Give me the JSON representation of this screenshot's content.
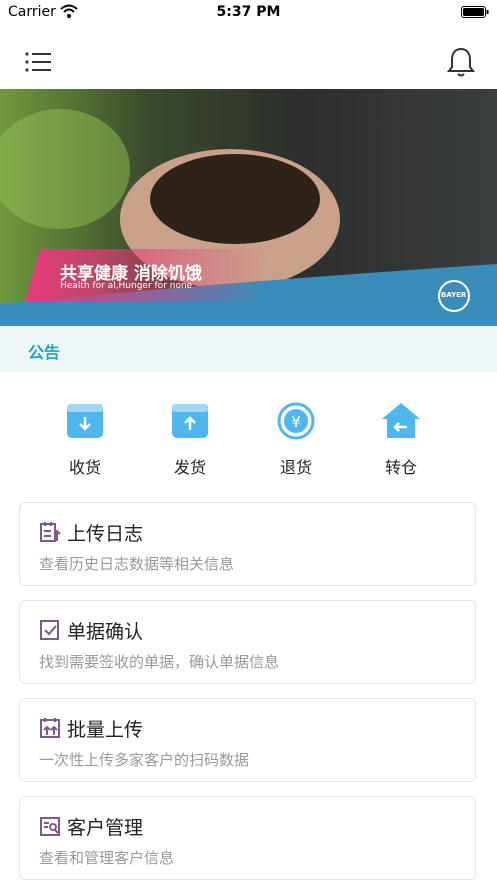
{
  "status_bar": {
    "carrier": "Carrier",
    "time": "5:37 PM"
  },
  "banner": {
    "title_cn": "共享健康 消除饥饿",
    "title_en": "Health for al,Hunger for none",
    "logo_text": "BAYER"
  },
  "notice": {
    "label": "公告"
  },
  "actions": [
    {
      "label": "收货",
      "icon": "receive-icon"
    },
    {
      "label": "发货",
      "icon": "ship-icon"
    },
    {
      "label": "退货",
      "icon": "return-icon"
    },
    {
      "label": "转仓",
      "icon": "transfer-icon"
    }
  ],
  "cards": [
    {
      "title": "上传日志",
      "desc": "查看历史日志数据等相关信息",
      "icon": "upload-log-icon"
    },
    {
      "title": "单据确认",
      "desc": "找到需要签收的单据，确认单据信息",
      "icon": "document-confirm-icon"
    },
    {
      "title": "批量上传",
      "desc": "一次性上传多家客户的扫码数据",
      "icon": "batch-upload-icon"
    },
    {
      "title": "客户管理",
      "desc": "查看和管理客户信息",
      "icon": "customer-manage-icon"
    }
  ],
  "colors": {
    "accent": "#1fa3b8",
    "icon_blue": "#3ba8e8",
    "card_icon": "#7b5a8e"
  }
}
